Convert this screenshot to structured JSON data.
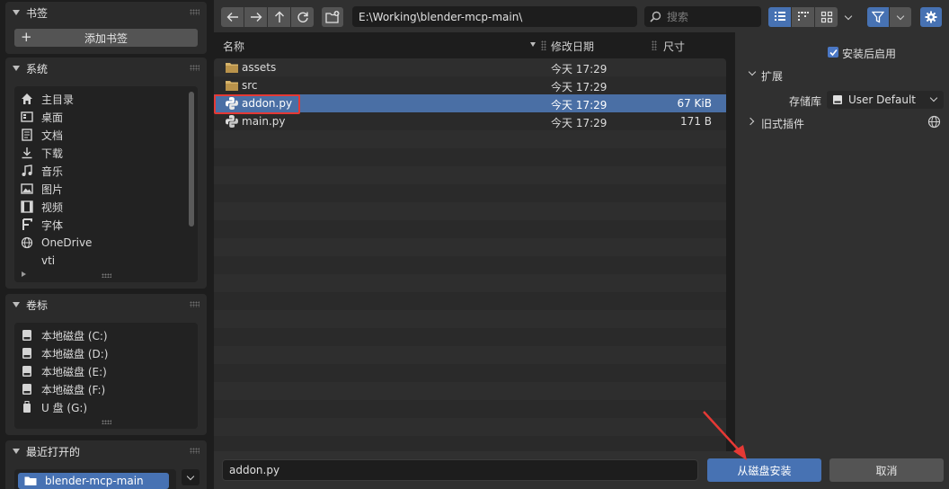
{
  "sidebar": {
    "bookmarks": {
      "title": "书签",
      "add_label": "添加书签"
    },
    "system": {
      "title": "系统",
      "items": [
        {
          "label": "主目录",
          "icon": "home-icon"
        },
        {
          "label": "桌面",
          "icon": "desktop-icon"
        },
        {
          "label": "文档",
          "icon": "documents-icon"
        },
        {
          "label": "下载",
          "icon": "download-icon"
        },
        {
          "label": "音乐",
          "icon": "music-icon"
        },
        {
          "label": "图片",
          "icon": "image-icon"
        },
        {
          "label": "视频",
          "icon": "video-icon"
        },
        {
          "label": "字体",
          "icon": "font-icon"
        },
        {
          "label": "OneDrive",
          "icon": "globe-icon"
        },
        {
          "label": "vti",
          "icon": "folder-icon"
        }
      ]
    },
    "volumes": {
      "title": "卷标",
      "items": [
        {
          "label": "本地磁盘 (C:)",
          "icon": "disk-icon"
        },
        {
          "label": "本地磁盘 (D:)",
          "icon": "disk-icon"
        },
        {
          "label": "本地磁盘 (E:)",
          "icon": "disk-icon"
        },
        {
          "label": "本地磁盘 (F:)",
          "icon": "disk-icon"
        },
        {
          "label": "U 盘 (G:)",
          "icon": "usb-drive-icon"
        }
      ]
    },
    "recent": {
      "title": "最近打开的",
      "items": [
        {
          "label": "blender-mcp-main",
          "icon": "folder-icon"
        }
      ]
    }
  },
  "toolbar": {
    "path": "E:\\Working\\blender-mcp-main\\",
    "search_placeholder": "搜索"
  },
  "file_list": {
    "columns": {
      "name": "名称",
      "date": "修改日期",
      "size": "尺寸"
    },
    "rows": [
      {
        "name": "assets",
        "date": "今天 17:29",
        "size": "",
        "type": "folder"
      },
      {
        "name": "src",
        "date": "今天 17:29",
        "size": "",
        "type": "folder"
      },
      {
        "name": "addon.py",
        "date": "今天 17:29",
        "size": "67 KiB",
        "type": "python",
        "selected": true
      },
      {
        "name": "main.py",
        "date": "今天 17:29",
        "size": "171 B",
        "type": "python"
      }
    ]
  },
  "options": {
    "enable_after_install": "安装后启用",
    "enable_checked": true,
    "extensions_label": "扩展",
    "repository_label": "存储库",
    "repository_value": "User Default",
    "legacy_addons_label": "旧式插件"
  },
  "bottom": {
    "filename": "addon.py",
    "install_label": "从磁盘安装",
    "cancel_label": "取消"
  },
  "colors": {
    "accent": "#4772b3",
    "selection": "#4a6fa5",
    "highlight_box": "#e53935"
  }
}
